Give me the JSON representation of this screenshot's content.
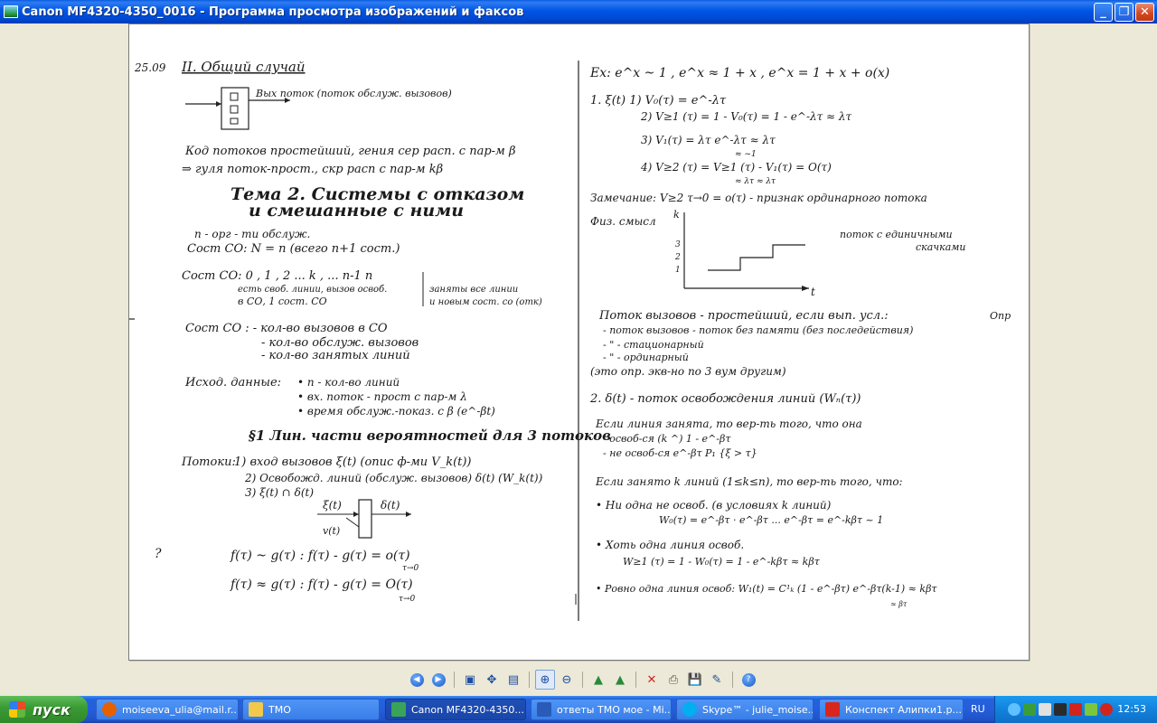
{
  "window": {
    "title": "Canon MF4320-4350_0016 - Программа просмотра изображений и факсов",
    "minimize_glyph": "_",
    "maximize_glyph": "❐",
    "close_glyph": "✕"
  },
  "toolbar": {
    "buttons": [
      {
        "name": "previous-image-icon"
      },
      {
        "name": "next-image-icon"
      },
      {
        "name": "best-fit-icon"
      },
      {
        "name": "actual-size-icon"
      },
      {
        "name": "slideshow-icon"
      },
      {
        "name": "zoom-in-icon"
      },
      {
        "name": "zoom-out-icon"
      },
      {
        "name": "rotate-clockwise-icon"
      },
      {
        "name": "rotate-counterclockwise-icon"
      },
      {
        "name": "delete-icon"
      },
      {
        "name": "print-icon"
      },
      {
        "name": "save-icon"
      },
      {
        "name": "edit-icon"
      },
      {
        "name": "help-icon"
      }
    ]
  },
  "taskbar": {
    "start_label": "пуск",
    "tasks": [
      {
        "label": "moiseeva_ulia@mail.r...",
        "icon": "firefox-icon",
        "color": "#e66000"
      },
      {
        "label": "ТМО",
        "icon": "folder-icon",
        "color": "#f2c94c"
      },
      {
        "label": "Canon MF4320-4350...",
        "icon": "image-viewer-icon",
        "color": "#3aa35a",
        "active": true
      },
      {
        "label": "ответы ТМО мое - Mi...",
        "icon": "word-icon",
        "color": "#2b5bb8"
      },
      {
        "label": "Skype™ - julie_moise...",
        "icon": "skype-icon",
        "color": "#00aff0"
      },
      {
        "label": "Конспект Алипки1.p...",
        "icon": "pdf-icon",
        "color": "#d9261c"
      }
    ],
    "language": "RU",
    "clock": "12:53"
  },
  "document": {
    "left": {
      "date": "25.09",
      "heading": "II. Общий случай",
      "box_label": "Вых поток (поток обслуж. вызовов)",
      "note1": "Код потоков простейший, гения сер расп. с пар-м β",
      "note2": "⇒ гуля поток-прост., скр расп с пар-м kβ",
      "topic1": "Тема 2. Системы с отказом",
      "topic2": "и смешанные с ними",
      "def1": "n - орг - ти обслуж.",
      "def2": "Сост СО: N = n (всего n+1 сост.)",
      "states": "Сост СО:   0 , 1 , 2 ...   k , ...   n-1   n",
      "states_sub1": "есть своб. линии, вызов освоб.",
      "states_sub2": "в СО, 1 сост. СО",
      "states_sub3": "заняты все линии",
      "states_sub4": "и новым сост. со (отк)",
      "so1": "Сост СО : - кол-во вызовов в СО",
      "so2": "- кол-во обслуж. вызовов",
      "so3": "- кол-во занятых линий",
      "init_title": "Исход. данные:",
      "init1": "• n - кол-во линий",
      "init2": "• вх. поток - прост с пар-м λ",
      "init3": "• время обслуж.-показ. с β (e^-βt)",
      "section3": "§1 Лин. части вероятностей для 3 потоков",
      "flows_title": "Потоки:",
      "flow1": "1) вход вызовов ξ(t) (опис ф-ми V_k(t))",
      "flow2": "2) Освобожд. линий (обслуж. вызовов) δ(t) (W_k(t))",
      "flow3": "3) ξ(t) ∩ δ(t)",
      "diag_in": "ξ(t)",
      "diag_out": "δ(t)",
      "diag_in2": "v(t)",
      "eq1": "f(τ) ~ g(τ) :  f(τ) - g(τ) = o(τ)",
      "eq1_sub": "τ→0",
      "eq2": "f(τ) ≈ g(τ) :  f(τ) - g(τ) = O(τ)",
      "eq2_sub": "τ→0",
      "margin_q": "?"
    },
    "right": {
      "ex": "Ex:  e^x ~ 1 ,  e^x ≈ 1 + x ,  e^x = 1 + x + o(x)",
      "item1": "1. ξ(t)   1) V₀(τ) = e^-λτ",
      "item1b": "2) V≥1 (τ) = 1 - V₀(τ) = 1 - e^-λτ ≈ λτ",
      "item1c": "3) V₁(τ) = λτ e^-λτ ≈ λτ",
      "item1d": "4) V≥2 (τ) = V≥1 (τ) - V₁(τ) = O(τ)",
      "item1e": "≈ ~1",
      "item1f": "≈ λτ   ≈ λτ",
      "remark": "Замечание:  V≥2 τ→0 = o(τ) - признак ординарного потока",
      "phys": "Физ. смысл",
      "graph_y": "k",
      "graph_x": "t",
      "graph_ticks": [
        "3",
        "2",
        "1"
      ],
      "graph_note1": "поток с единичными",
      "graph_note2": "скачками",
      "simple1": "Поток вызовов - простейший, если вып. усл.:",
      "simple1b": "Опр",
      "simple2": "- поток вызовов - поток без памяти (без последействия)",
      "simple3": "- \" - стационарный",
      "simple4": "- \" - ординарный",
      "simple5": "(это опр. экв-но по 3 вум другим)",
      "item2": "2. δ(t) - поток освобождения линий  (Wₙ(τ))",
      "busy1": "Если линия занята, то вер-ть того, что она",
      "busy2": "- освоб-ся (k ^)   1 - e^-βτ",
      "busy3": "- не освоб-ся       e^-βτ      P₁ {ξ > τ}",
      "k_busy": "Если занято k линий (1≤k≤n), то вер-ть того, что:",
      "kb1": "• Ни одна не освоб. (в условиях k линий)",
      "kb1b": "W₀(τ) = e^-βτ · e^-βτ ... e^-βτ = e^-kβτ ~ 1",
      "kb2": "• Хоть одна линия освоб.",
      "kb2b": "W≥1 (τ) = 1 - W₀(τ) = 1 - e^-kβτ ≈ kβτ",
      "kb3": "• Ровно одна линия освоб:  W₁(t) = C¹ₖ (1 - e^-βτ) e^-βτ(k-1) ≈ kβτ",
      "kb3_sub": "≈ βτ"
    }
  }
}
